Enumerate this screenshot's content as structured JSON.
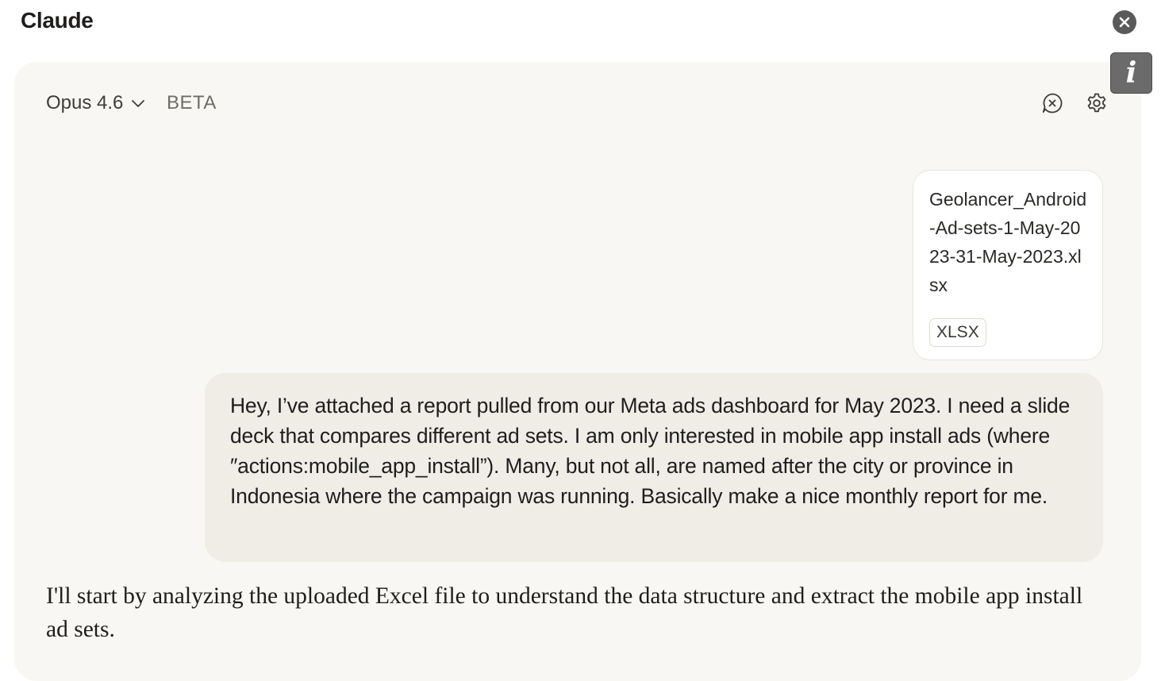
{
  "window": {
    "title": "Claude",
    "close_icon": "close-circle-icon",
    "info_label": "i"
  },
  "header": {
    "model_name": "Opus 4.6",
    "model_dropdown_icon": "chevron-down-icon",
    "beta_label": "BETA",
    "clear_chat_icon": "chat-clear-icon",
    "settings_icon": "gear-icon"
  },
  "attachment": {
    "file_name": "Geolancer_Android-Ad-sets-1-May-2023-31-May-2023.xlsx",
    "file_type": "XLSX"
  },
  "conversation": {
    "user_message": "Hey, I’ve attached a report pulled from our Meta ads dashboard for May 2023. I need a slide deck that compares different ad sets. I am only interested in mobile app install ads (where ″actions:mobile_app_install”). Many, but not all, are named after the city or province in Indonesia where the campaign was running. Basically make a nice monthly report for me.",
    "assistant_message": "I'll start by analyzing the uploaded Excel file to understand the data structure and extract the mobile app install ad sets."
  },
  "colors": {
    "panel_background": "#f8f7f3",
    "user_bubble": "#efede6",
    "text": "#1f1e1d"
  }
}
